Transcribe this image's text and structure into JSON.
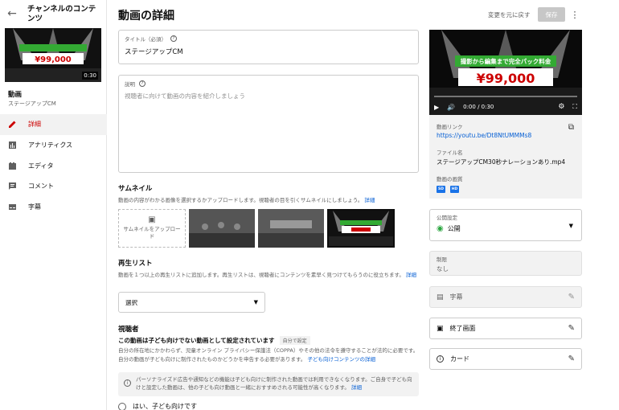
{
  "sidebar": {
    "header_title": "チャンネルのコンテンツ",
    "video_title": "動画",
    "video_subtitle": "ステージアップCM",
    "thumb_duration": "0:30",
    "nav": [
      {
        "label": "詳細",
        "icon": "pencil-icon",
        "active": true
      },
      {
        "label": "アナリティクス",
        "icon": "analytics-icon",
        "active": false
      },
      {
        "label": "エディタ",
        "icon": "editor-icon",
        "active": false
      },
      {
        "label": "コメント",
        "icon": "comment-icon",
        "active": false
      },
      {
        "label": "字幕",
        "icon": "subtitles-icon",
        "active": false
      }
    ]
  },
  "header": {
    "title": "動画の詳細",
    "revert_label": "変更を元に戻す",
    "save_label": "保存"
  },
  "title_field": {
    "label": "タイトル（必須）",
    "value": "ステージアップCM"
  },
  "desc_field": {
    "label": "説明",
    "placeholder": "視聴者に向けて動画の内容を紹介しましょう"
  },
  "thumbnail": {
    "title": "サムネイル",
    "desc": "動画の内容がわかる画像を選択するかアップロードします。視聴者の目を引くサムネイルにしましょう。",
    "detail_link": "詳細",
    "upload_label": "サムネイルをアップロード"
  },
  "playlist": {
    "title": "再生リスト",
    "desc": "動画を１つ以上の再生リストに追加します。再生リストは、視聴者にコンテンツを素早く見つけてもらうのに役立ちます。",
    "detail_link": "詳細",
    "select_value": "選択"
  },
  "audience": {
    "title": "視聴者",
    "status": "この動画は子ども向けでない動画として設定されています",
    "status_badge": "自分で設定",
    "desc": "自分の所在地にかかわらず、児童オンライン プライバシー保護法（COPPA）やその他の法令を遵守することが法的に必要です。自分の動画が子ども向けに制作されたものかどうかを申告する必要があります。",
    "link": "子ども向けコンテンツの詳細",
    "info": "パーソナライズド広告や通知などの機能は子ども向けに制作された動画では利用できなくなります。ご自身で子ども向けと設定した動画は、他の子ども向け動画と一緒におすすめされる可能性が高くなります。",
    "info_link": "詳細",
    "radio_yes": "はい、子ども向けです"
  },
  "preview": {
    "price_text": "¥99,000",
    "banner_text": "撮影から編集まで完全パック料金",
    "time": "0:00 / 0:30",
    "link_label": "動画リンク",
    "link": "https://youtu.be/Dt8NtUMMMs8",
    "file_label": "ファイル名",
    "file_name": "ステージアップCM30秒ナレーションあり.mp4",
    "quality_label": "動画の画質",
    "quality_badges": [
      "SD",
      "HD"
    ]
  },
  "visibility": {
    "label": "公開設定",
    "value": "公開"
  },
  "restrictions": {
    "label": "制限",
    "value": "なし"
  },
  "subtitles_row": "字幕",
  "end_screen_row": "終了画面",
  "cards_row": "カード"
}
